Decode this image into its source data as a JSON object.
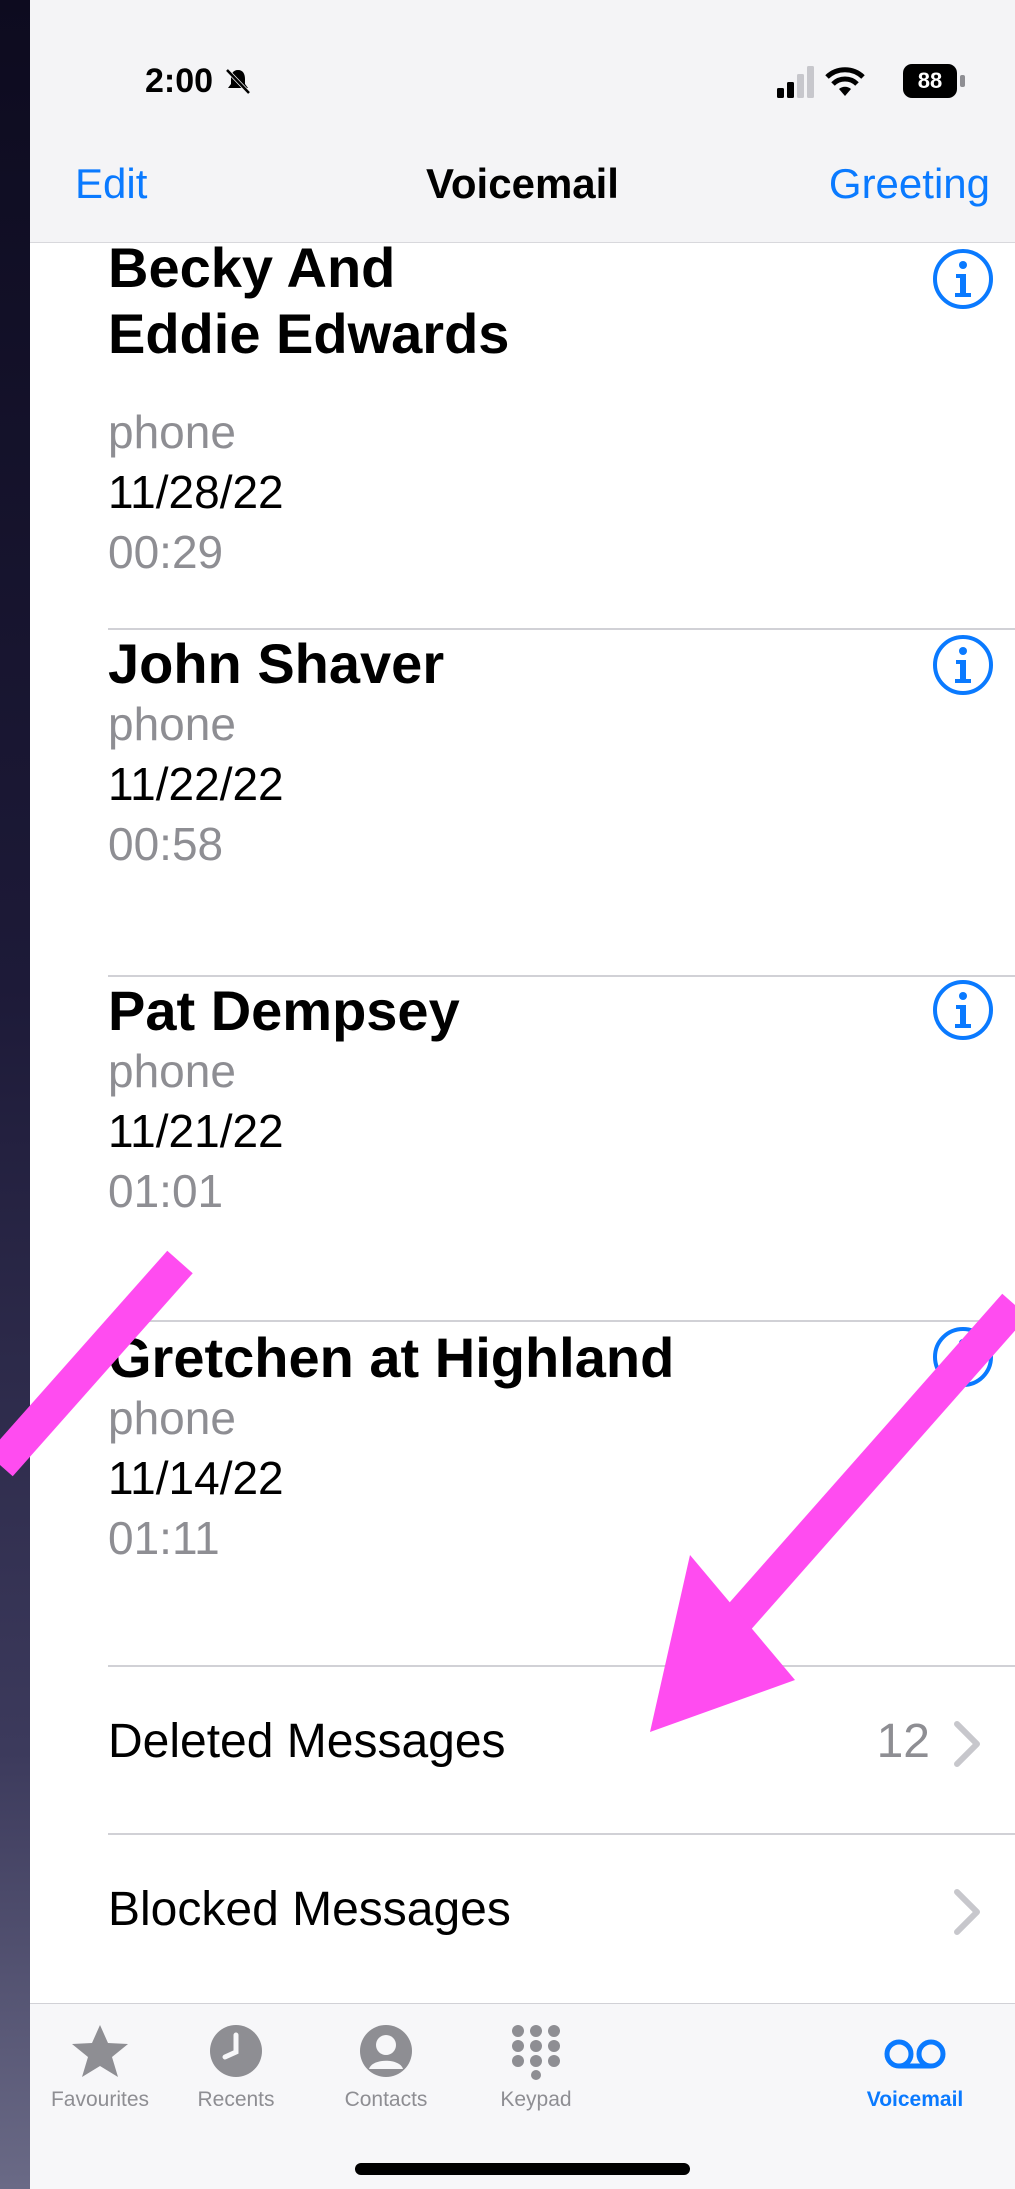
{
  "status_bar": {
    "time": "2:00",
    "battery": "88"
  },
  "nav": {
    "edit_label": "Edit",
    "title": "Voicemail",
    "greeting_label": "Greeting"
  },
  "voicemails": [
    {
      "name_line1": "Becky And",
      "name_line2": "Eddie Edwards",
      "type": "phone",
      "date": "11/28/22",
      "duration": "00:29"
    },
    {
      "name": "John Shaver",
      "type": "phone",
      "date": "11/22/22",
      "duration": "00:58"
    },
    {
      "name": "Pat Dempsey",
      "type": "phone",
      "date": "11/21/22",
      "duration": "01:01"
    },
    {
      "name": "Gretchen at Highland",
      "type": "phone",
      "date": "11/14/22",
      "duration": "01:11"
    }
  ],
  "deleted_messages": {
    "label": "Deleted Messages",
    "count": "12"
  },
  "blocked_messages": {
    "label": "Blocked Messages"
  },
  "tabs": [
    {
      "label": "Favourites",
      "icon": "star-icon"
    },
    {
      "label": "Recents",
      "icon": "clock-icon"
    },
    {
      "label": "Contacts",
      "icon": "person-icon"
    },
    {
      "label": "Keypad",
      "icon": "keypad-icon"
    },
    {
      "label": "Voicemail",
      "icon": "voicemail-icon"
    }
  ],
  "colors": {
    "accent": "#0a7aff",
    "annotation_arrow": "#ff4cf0",
    "secondary_text": "#8e8e93"
  }
}
